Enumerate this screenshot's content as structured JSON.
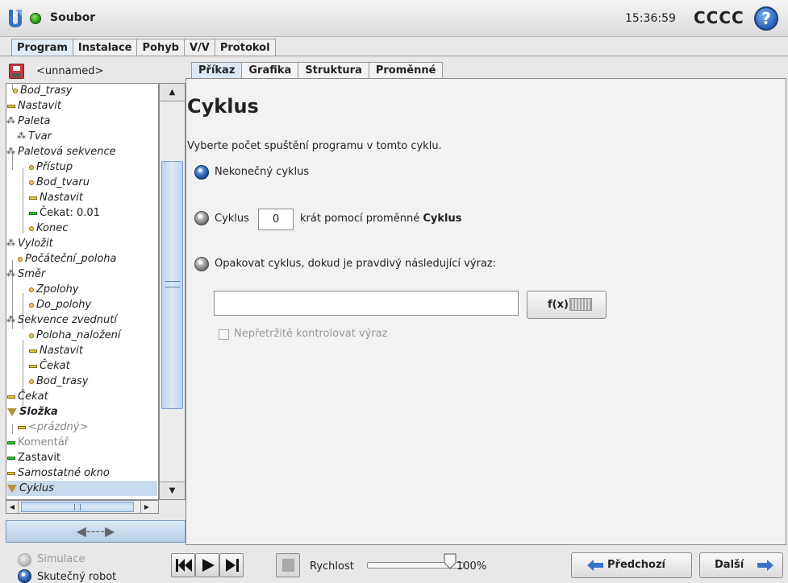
{
  "header": {
    "file_title": "Soubor",
    "clock": "15:36:59",
    "robot_name": "CCCC",
    "help_glyph": "?"
  },
  "main_tabs": [
    {
      "label": "Program",
      "active": true
    },
    {
      "label": "Instalace",
      "active": false
    },
    {
      "label": "Pohyb",
      "active": false
    },
    {
      "label": "V/V",
      "active": false
    },
    {
      "label": "Protokol",
      "active": false
    }
  ],
  "program": {
    "name": "<unnamed>",
    "tree": [
      {
        "label": "Bod_trasy",
        "icon": "waypoint",
        "depth": 1
      },
      {
        "label": "Nastavit",
        "icon": "set-bar",
        "depth": 0
      },
      {
        "label": "Paleta",
        "icon": "pallet",
        "depth": 0
      },
      {
        "label": "Tvar",
        "icon": "pallet",
        "depth": 1
      },
      {
        "label": "Paletová sekvence",
        "icon": "pallet",
        "depth": 1
      },
      {
        "label": "Přístup",
        "icon": "waypoint",
        "depth": 2
      },
      {
        "label": "Bod_tvaru",
        "icon": "waypoint",
        "depth": 2
      },
      {
        "label": "Nastavit",
        "icon": "set-bar",
        "depth": 2
      },
      {
        "label": "Čekat: 0.01",
        "icon": "wait-bar",
        "depth": 2
      },
      {
        "label": "Konec",
        "icon": "waypoint",
        "depth": 2
      },
      {
        "label": "Vyložit",
        "icon": "pallet",
        "depth": 0
      },
      {
        "label": "Počáteční_poloha",
        "icon": "waypoint",
        "depth": 1
      },
      {
        "label": "Směr",
        "icon": "pallet",
        "depth": 1
      },
      {
        "label": "Zpolohy",
        "icon": "waypoint",
        "depth": 2
      },
      {
        "label": "Do_polohy",
        "icon": "waypoint",
        "depth": 2
      },
      {
        "label": "Sekvence zvednutí",
        "icon": "pallet",
        "depth": 1
      },
      {
        "label": "Poloha_naložení",
        "icon": "waypoint",
        "depth": 2
      },
      {
        "label": "Nastavit",
        "icon": "set-bar",
        "depth": 2
      },
      {
        "label": "Čekat",
        "icon": "set-bar",
        "depth": 2
      },
      {
        "label": "Bod_trasy",
        "icon": "waypoint",
        "depth": 2
      },
      {
        "label": "Čekat",
        "icon": "set-bar",
        "depth": 0
      },
      {
        "label": "Složka",
        "icon": "folder-triangle",
        "depth": 0
      },
      {
        "label": "<prázdný>",
        "icon": "set-bar",
        "depth": 1
      },
      {
        "label": "Komentář",
        "icon": "comment-bar",
        "depth": 0
      },
      {
        "label": "Zastavit",
        "icon": "stop-bar",
        "depth": 0
      },
      {
        "label": "Samostatné okno",
        "icon": "set-bar",
        "depth": 0
      },
      {
        "label": "Cyklus",
        "icon": "folder-triangle",
        "depth": 0
      }
    ],
    "collapse_glyph": "◀----▶"
  },
  "sub_tabs": [
    {
      "label": "Příkaz",
      "active": true
    },
    {
      "label": "Grafika",
      "active": false
    },
    {
      "label": "Struktura",
      "active": false
    },
    {
      "label": "Proměnné",
      "active": false
    }
  ],
  "command": {
    "title": "Cyklus",
    "description": "Vyberte počet spuštění programu v tomto cyklu.",
    "options": {
      "infinite_label": "Nekonečný cyklus",
      "count_prefix": "Cyklus",
      "count_value": "0",
      "count_suffix_plain": "krát pomocí proměnné ",
      "count_suffix_bold": "Cyklus",
      "expression_label": "Opakovat cyklus, dokud je pravdivý následující výraz:"
    },
    "selected_option": "infinite",
    "expression_value": "",
    "fx_label": "f(x)",
    "continuous_check_label": "Nepřetržitě kontrolovat výraz"
  },
  "footer": {
    "simulation_label": "Simulace",
    "real_robot_label": "Skutečný robot",
    "speed_label": "Rychlost",
    "speed_value": "100%",
    "speed_fraction": 1.0,
    "prev_label": "Předchozí",
    "next_label": "Další"
  },
  "colors": {
    "accent_blue": "#2c64b8",
    "status_green": "#2c9a1b",
    "selected_row": "#c9d9ee"
  }
}
